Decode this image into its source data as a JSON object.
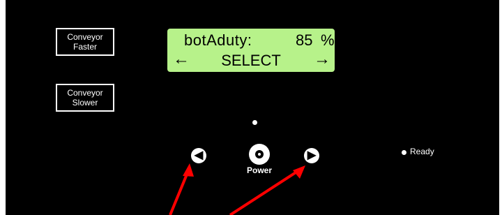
{
  "buttons": {
    "faster": {
      "line1": "Conveyor",
      "line2": "Faster"
    },
    "slower": {
      "line1": "Conveyor",
      "line2": "Slower"
    }
  },
  "lcd": {
    "param": "botAduty:",
    "value": "85",
    "unit": "%",
    "mode": "SELECT",
    "left_arrow": "←",
    "right_arrow": "→"
  },
  "controls": {
    "left_symbol": "◀",
    "right_symbol": "▶",
    "power_label": "Power",
    "ready_label": "Ready"
  },
  "colors": {
    "panel": "#000000",
    "lcd": "#b7f28a",
    "annotation": "#ff0000"
  },
  "icons": [
    "left-arrow-button-icon",
    "right-arrow-button-icon",
    "power-icon",
    "status-led-icon"
  ]
}
